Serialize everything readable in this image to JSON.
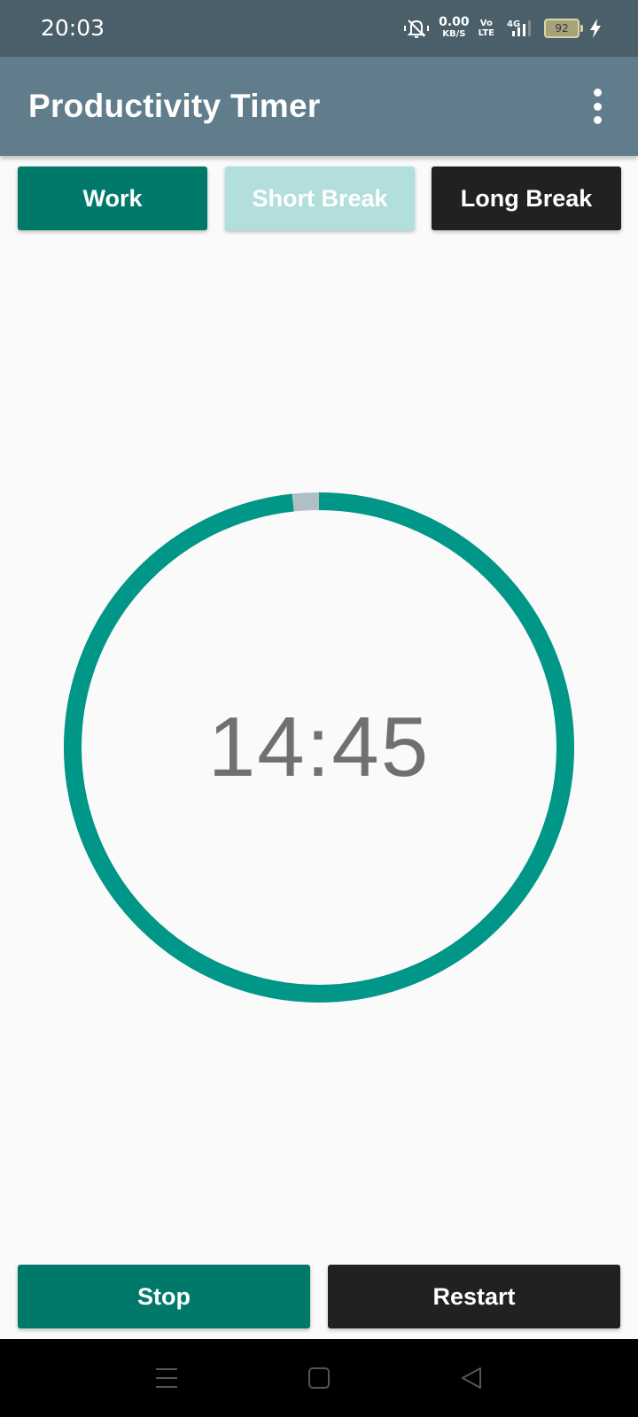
{
  "status_bar": {
    "time": "20:03",
    "net_speed": "0.00",
    "net_speed_unit": "KB/S",
    "volte_top": "Vo",
    "volte_bottom": "LTE",
    "network": "4G",
    "battery": "92"
  },
  "app_bar": {
    "title": "Productivity Timer",
    "menu_icon": "more-vert-icon"
  },
  "modes": {
    "work_label": "Work",
    "short_break_label": "Short Break",
    "long_break_label": "Long Break"
  },
  "timer": {
    "display": "14:45",
    "progress_fraction": 0.983,
    "ring_color": "#009688",
    "remaining_color": "#b0bec5"
  },
  "controls": {
    "stop_label": "Stop",
    "restart_label": "Restart"
  },
  "colors": {
    "status_bar": "#4a5f69",
    "app_bar": "#617d8b",
    "work_button": "#00796b",
    "short_break_button": "#b2dfdb",
    "long_break_button": "#212121",
    "restart_button": "#212121"
  }
}
